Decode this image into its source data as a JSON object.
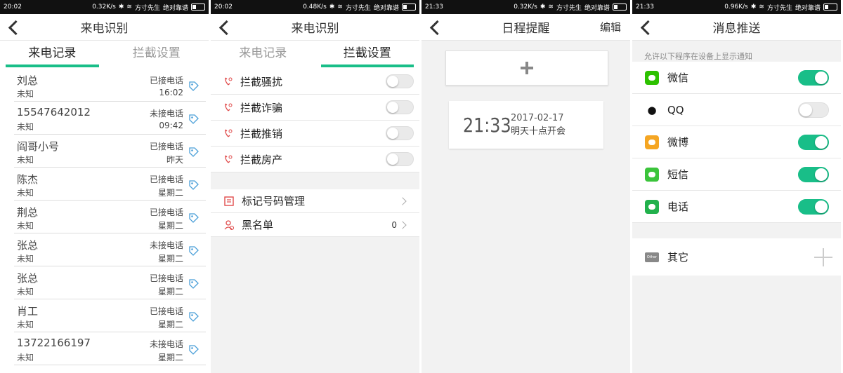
{
  "panels": [
    {
      "status": {
        "time": "20:02",
        "speed": "0.32K/s",
        "carrier1": "方寸先生",
        "carrier2": "绝对靠谱"
      },
      "title": "来电识别",
      "tabs": [
        "来电记录",
        "拦截设置"
      ],
      "calls": [
        {
          "name": "刘总",
          "sub": "未知",
          "status": "已接电话",
          "time": "16:02"
        },
        {
          "name": "15547642012",
          "sub": "未知",
          "status": "未接电话",
          "time": "09:42"
        },
        {
          "name": "阎哥小号",
          "sub": "未知",
          "status": "已接电话",
          "time": "昨天"
        },
        {
          "name": "陈杰",
          "sub": "未知",
          "status": "已接电话",
          "time": "星期二"
        },
        {
          "name": "荆总",
          "sub": "未知",
          "status": "已接电话",
          "time": "星期二"
        },
        {
          "name": "张总",
          "sub": "未知",
          "status": "未接电话",
          "time": "星期二"
        },
        {
          "name": "张总",
          "sub": "未知",
          "status": "已接电话",
          "time": "星期二"
        },
        {
          "name": "肖工",
          "sub": "未知",
          "status": "已接电话",
          "time": "星期二"
        },
        {
          "name": "13722166197",
          "sub": "未知",
          "status": "未接电话",
          "time": "星期二"
        }
      ]
    },
    {
      "status": {
        "time": "20:02",
        "speed": "0.48K/s",
        "carrier1": "方寸先生",
        "carrier2": "绝对靠谱"
      },
      "title": "来电识别",
      "tabs": [
        "来电记录",
        "拦截设置"
      ],
      "block_items": [
        {
          "label": "拦截骚扰",
          "on": false
        },
        {
          "label": "拦截诈骗",
          "on": false
        },
        {
          "label": "拦截推销",
          "on": false
        },
        {
          "label": "拦截房产",
          "on": false
        }
      ],
      "nav_items": [
        {
          "label": "标记号码管理",
          "count": ""
        },
        {
          "label": "黑名单",
          "count": "0"
        }
      ]
    },
    {
      "status": {
        "time": "21:33",
        "speed": "0.32K/s",
        "carrier1": "方寸先生",
        "carrier2": "绝对靠谱"
      },
      "title": "日程提醒",
      "edit_label": "编辑",
      "schedule": {
        "time": "21:33",
        "date": "2017-02-17",
        "text": "明天十点开会"
      }
    },
    {
      "status": {
        "time": "21:33",
        "speed": "0.96K/s",
        "carrier1": "方寸先生",
        "carrier2": "绝对靠谱"
      },
      "title": "消息推送",
      "hint": "允许以下程序在设备上显示通知",
      "apps": [
        {
          "label": "微信",
          "on": true,
          "icon": "wechat-icon",
          "color": "#2dc100"
        },
        {
          "label": "QQ",
          "on": false,
          "icon": "qq-icon",
          "color": "#111111"
        },
        {
          "label": "微博",
          "on": true,
          "icon": "weibo-icon",
          "color": "#f5a623"
        },
        {
          "label": "短信",
          "on": true,
          "icon": "sms-icon",
          "color": "#3bc43b"
        },
        {
          "label": "电话",
          "on": true,
          "icon": "phone-icon",
          "color": "#22b14c"
        }
      ],
      "other_label": "其它",
      "other_icon_text": "Other"
    }
  ],
  "colors": {
    "accent": "#19be88",
    "block_icon": "#e04b4b"
  }
}
